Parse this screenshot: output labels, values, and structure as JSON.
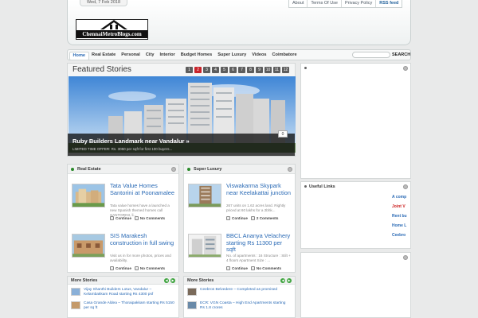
{
  "header": {
    "date": "Wed, 7 Feb 2018",
    "logo_text": "ChennaiMetroBlogs.com",
    "top_links": [
      "About",
      "Terms Of Use",
      "Privacy Policy",
      "RSS feed"
    ]
  },
  "nav": {
    "items": [
      "Home",
      "Real Estate",
      "Personal",
      "City",
      "Interior",
      "Budget Homes",
      "Super Luxury",
      "Videos",
      "Coimbatore"
    ],
    "active": "Home",
    "search_label": "SEARCH"
  },
  "featured": {
    "title": "Featured Stories",
    "pages": [
      "1",
      "2",
      "3",
      "4",
      "5",
      "6",
      "7",
      "8",
      "9",
      "10",
      "11",
      "12"
    ],
    "active_page": "2",
    "story_title": "Ruby Builders Landmark near Vandalur »",
    "story_sub": "LIMITED TIME OFFER: Rs. 3050 per sqft for first 100 buyers...",
    "comment_count": "0"
  },
  "real_estate": {
    "title": "Real Estate",
    "items": [
      {
        "title": "Tata Value Homes Santorini at Poonamalee",
        "excerpt": "Tata value homes have a launched a new Spanish themed homes call SANTORINI, li...",
        "continue": "Continue",
        "comments": "No Comments"
      },
      {
        "title": "SIS Marakesh construction in full swing",
        "excerpt": "Visit us in for more photos, prices and availability.",
        "continue": "Continue",
        "comments": "No Comments"
      }
    ]
  },
  "super_luxury": {
    "title": "Super Luxury",
    "items": [
      {
        "title": "Viswakarma Skypark near Keelakattai junction",
        "excerpt": "267 units on 1.62 acres land. Rightly priced at 60 lakhs for a 2bhk...",
        "continue": "Continue",
        "comments": "2 Comments"
      },
      {
        "title": "BBCL Ananya Velachery starting Rs 11300 per sqft",
        "excerpt": "No. of apartments : 16 Structure : Stilt + 4 floors Apartment Size : ...",
        "continue": "Continue",
        "comments": "No Comments"
      }
    ]
  },
  "more_left": {
    "title": "More Stories",
    "items": [
      "Vijay Shanthi Builders Lotus, Vandalur – Kelambakkam Road starting Rs 4300 psf",
      "Casa Grande Aldea – Thoraipakkam starting Rs 5150 per sq ft"
    ]
  },
  "more_right": {
    "title": "More Stories",
    "items": [
      "Ceebros Belvedere – Completed as promised",
      "ECR: VGN Coasta – High End Apartments starting Rs 1.8 crores"
    ]
  },
  "useful_links": {
    "title": "Useful Links",
    "items": [
      "A comp",
      "Joint V",
      "Rent bu",
      "Home L",
      "Ceebro"
    ]
  }
}
